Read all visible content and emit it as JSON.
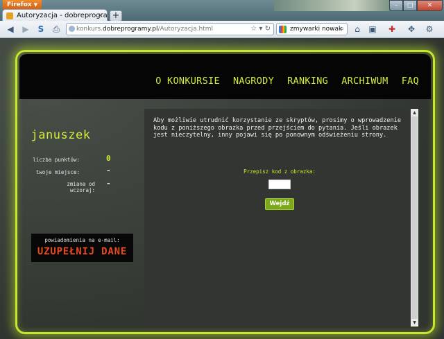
{
  "browser": {
    "app_button": "Firefox",
    "tab_title": "Autoryzacja - dobreprogramy",
    "new_tab": "+",
    "url_prefix": "konkurs.",
    "url_domain": "dobreprogramy.pl",
    "url_path": "/Autoryzacja.html",
    "search_value": "zmywarki nowak"
  },
  "nav": {
    "items": [
      "O KONKURSIE",
      "NAGRODY",
      "RANKING",
      "ARCHIWUM",
      "FAQ"
    ]
  },
  "user": {
    "name": "januszek",
    "points_label": "liczba punktów:",
    "points_value": "0",
    "place_label": "twoje miejsce:",
    "place_value": "-",
    "change_label": "zmiana od wczoraj:",
    "change_value": "-"
  },
  "notify": {
    "label": "powiadomienia na e-mail:",
    "cta": "UZUPEŁNIJ DANE"
  },
  "content": {
    "message": "Aby możliwie utrudnić korzystanie ze skryptów, prosimy o wprowadzenie kodu z poniższego obrazka przed przejściem do pytania. Jeśli obrazek jest nieczytelny, inny pojawi się po ponownym odświeżeniu strony.",
    "captcha_label": "Przepisz kod z obrazka:",
    "submit_label": "Wejdź"
  },
  "colors": {
    "accent": "#c8e62c",
    "cta": "#e84a20",
    "button": "#7aa818"
  }
}
